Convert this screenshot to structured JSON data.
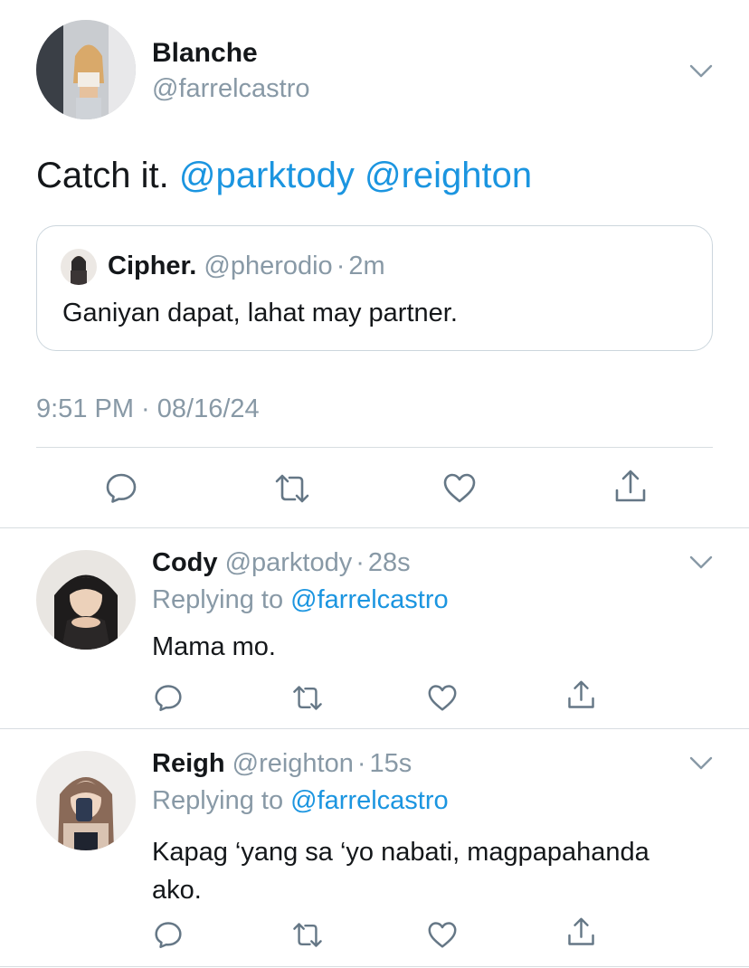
{
  "main_tweet": {
    "display_name": "Blanche",
    "handle": "@farrelcastro",
    "text_plain": "Catch it. ",
    "mention_1": "@parktody",
    "mention_2": "@reighton",
    "quote": {
      "display_name": "Cipher.",
      "handle": "@pherodio",
      "separator": "·",
      "time": "2m",
      "text": "Ganiyan dapat, lahat may partner."
    },
    "timestamp": "9:51 PM · 08/16/24"
  },
  "replies": [
    {
      "display_name": "Cody",
      "handle": "@parktody",
      "separator": "·",
      "time": "28s",
      "replying_label": "Replying to ",
      "replying_handle": "@farrelcastro",
      "text_line1": "Mama mo.",
      "text_line2": ""
    },
    {
      "display_name": "Reigh",
      "handle": "@reighton",
      "separator": "·",
      "time": "15s",
      "replying_label": "Replying to ",
      "replying_handle": "@farrelcastro",
      "text_line1": "Kapag ‘yang sa ‘yo nabati, magpapahanda",
      "text_line2": "ako."
    }
  ],
  "icons": [
    "reply-icon",
    "retweet-icon",
    "like-icon",
    "share-icon",
    "chevron-down-icon"
  ],
  "colors": {
    "link": "#1b95e0",
    "secondary": "#8899a6",
    "icon": "#657786",
    "text": "#14171a"
  }
}
